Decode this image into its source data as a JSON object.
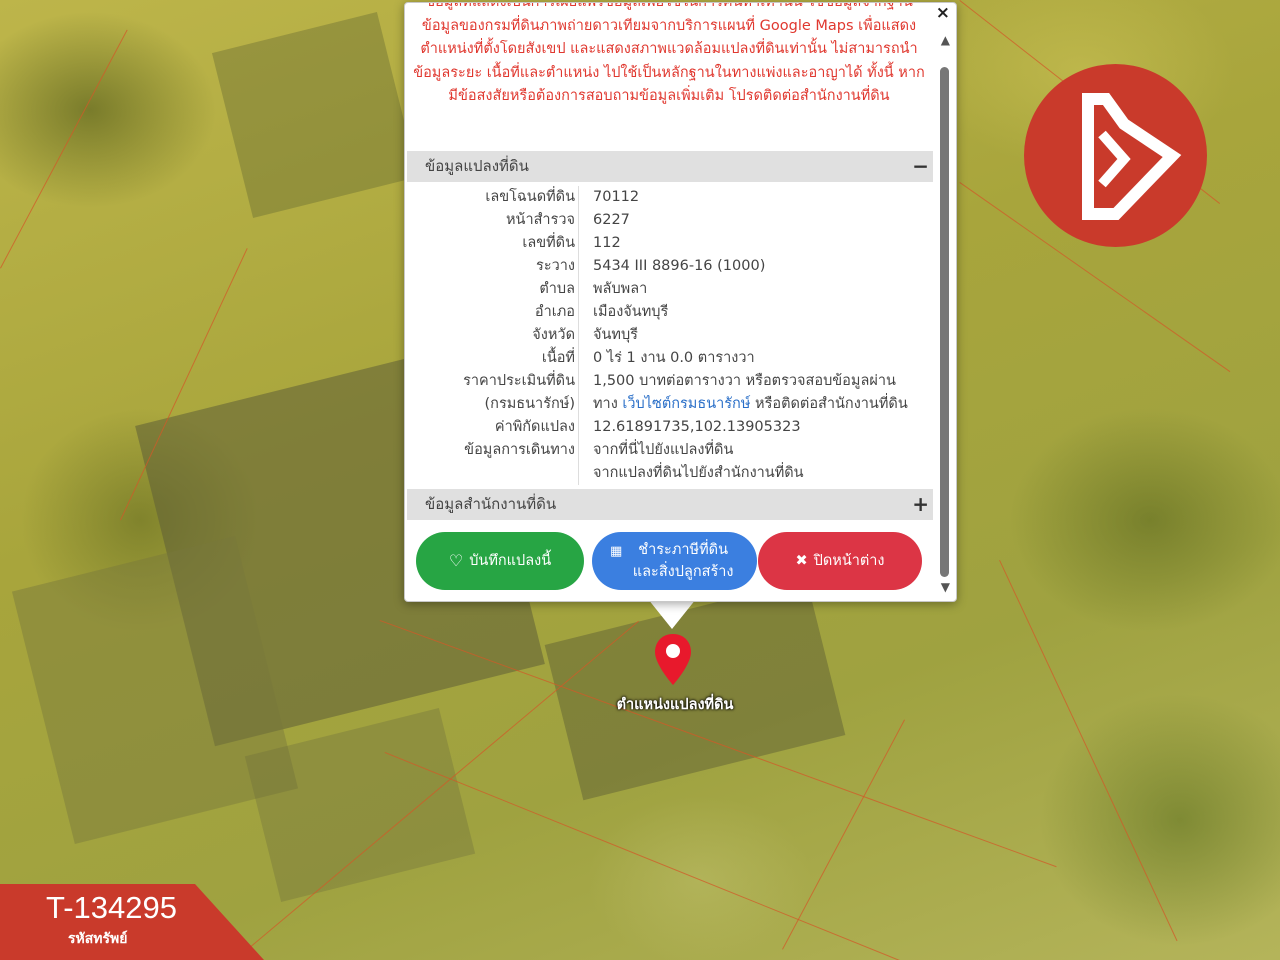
{
  "popup": {
    "close_label": "×",
    "notice": "ข้อมูลที่แสดงเป็นการเผยแพร่ข้อมูลเพื่อใช้ในการค้นหาเท่านั้น ใช้ข้อมูลจากฐานข้อมูลของกรมที่ดินภาพถ่ายดาวเทียมจากบริการแผนที่ Google Maps เพื่อแสดงตำแหน่งที่ตั้งโดยสังเขป และแสดงสภาพแวดล้อมแปลงที่ดินเท่านั้น ไม่สามารถนำข้อมูลระยะ เนื้อที่และตำแหน่ง ไปใช้เป็นหลักฐานในทางแพ่งและอาญาได้ ทั้งนี้ หากมีข้อสงสัยหรือต้องการสอบถามข้อมูลเพิ่มเติม โปรดติดต่อสำนักงานที่ดิน",
    "land_section": {
      "title": "ข้อมูลแปลงที่ดิน",
      "toggle": "−",
      "rows": [
        {
          "label": "เลขโฉนดที่ดิน",
          "value": "70112"
        },
        {
          "label": "หน้าสำรวจ",
          "value": "6227"
        },
        {
          "label": "เลขที่ดิน",
          "value": "112"
        },
        {
          "label": "ระวาง",
          "value": "5434 III 8896-16 (1000)"
        },
        {
          "label": "ตำบล",
          "value": "พลับพลา"
        },
        {
          "label": "อำเภอ",
          "value": "เมืองจันทบุรี"
        },
        {
          "label": "จังหวัด",
          "value": "จันทบุรี"
        },
        {
          "label": "เนื้อที่",
          "value": "0 ไร่ 1 งาน 0.0 ตารางวา"
        },
        {
          "label": "ราคาประเมินที่ดิน",
          "value": "1,500 บาทต่อตารางวา หรือตรวจสอบข้อมูลผ่าน"
        },
        {
          "label": "(กรมธนารักษ์)",
          "value_pre": "ทาง ",
          "value_link": "เว็บไซต์กรมธนารักษ์",
          "value_post": " หรือติดต่อสำนักงานที่ดิน"
        },
        {
          "label": "ค่าพิกัดแปลง",
          "value_link": "12.61891735,102.13905323"
        },
        {
          "label": "ข้อมูลการเดินทาง",
          "value_link": "จากที่นี่ไปยังแปลงที่ดิน"
        },
        {
          "label": "",
          "value_link": "จากแปลงที่ดินไปยังสำนักงานที่ดิน"
        }
      ]
    },
    "office_section": {
      "title": "ข้อมูลสำนักงานที่ดิน",
      "toggle": "+"
    },
    "buttons": {
      "save": "บันทึกแปลงนี้",
      "tax": "ชำระภาษีที่ดินและสิ่งปลูกสร้าง",
      "close": "ปิดหน้าต่าง"
    }
  },
  "map": {
    "marker_label": "ตำแหน่งแปลงที่ดิน",
    "marker_color": "#e8192c"
  },
  "listing": {
    "code": "T-134295",
    "code_caption": "รหัสทรัพย์",
    "brand_color": "#c93a2b"
  }
}
